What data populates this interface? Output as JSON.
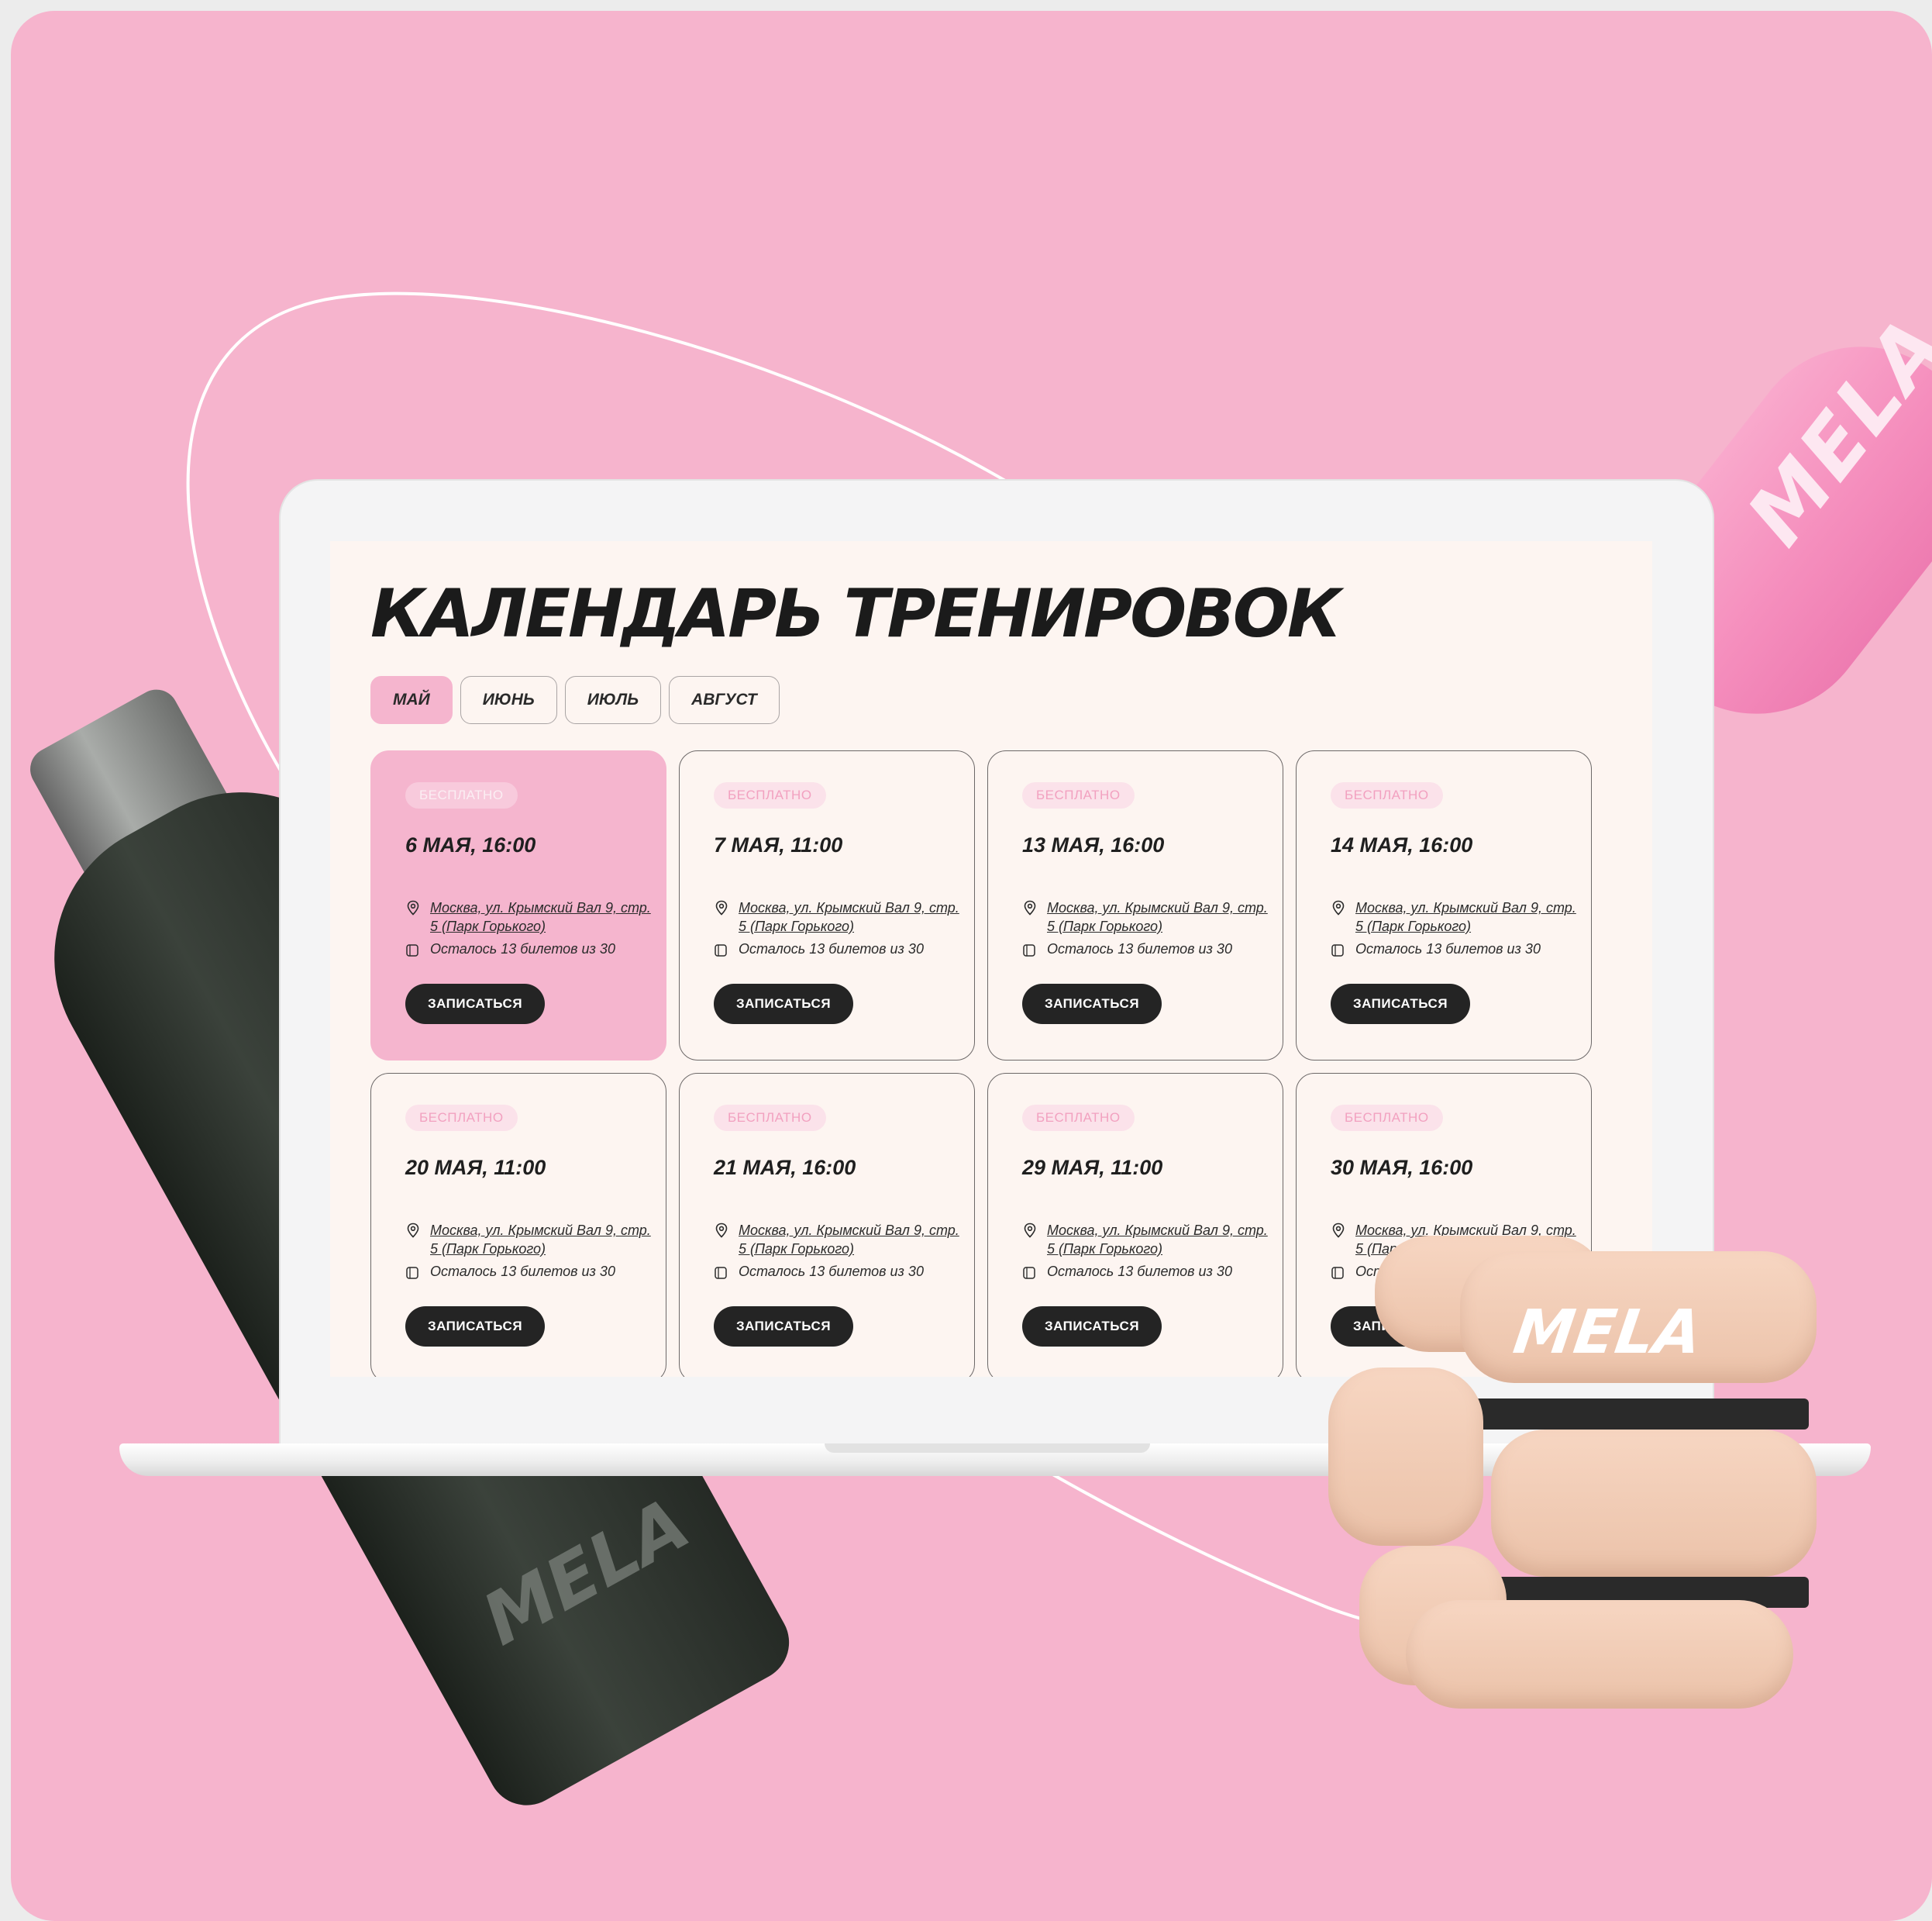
{
  "page": {
    "title": "КАЛЕНДАРЬ ТРЕНИРОВОК",
    "brand": "MELA",
    "accent_color": "#f5b5ce",
    "dark_color": "#242424",
    "background_color": "#f6b4cd"
  },
  "tabs": [
    {
      "label": "МАЙ",
      "active": true
    },
    {
      "label": "ИЮНЬ",
      "active": false
    },
    {
      "label": "ИЮЛЬ",
      "active": false
    },
    {
      "label": "АВГУСТ",
      "active": false
    }
  ],
  "cards": [
    {
      "badge": "БЕСПЛАТНО",
      "date": "6 МАЯ, 16:00",
      "address": "Москва, ул. Крымский Вал 9, стр. 5 (Парк Горького)",
      "tickets": "Осталось 13 билетов из 30",
      "button": "ЗАПИСАТЬСЯ",
      "highlighted": true
    },
    {
      "badge": "БЕСПЛАТНО",
      "date": "7 МАЯ, 11:00",
      "address": "Москва, ул. Крымский Вал 9, стр. 5 (Парк Горького)",
      "tickets": "Осталось 13 билетов из 30",
      "button": "ЗАПИСАТЬСЯ",
      "highlighted": false
    },
    {
      "badge": "БЕСПЛАТНО",
      "date": "13 МАЯ, 16:00",
      "address": "Москва, ул. Крымский Вал 9, стр. 5 (Парк Горького)",
      "tickets": "Осталось 13 билетов из 30",
      "button": "ЗАПИСАТЬСЯ",
      "highlighted": false
    },
    {
      "badge": "БЕСПЛАТНО",
      "date": "14 МАЯ, 16:00",
      "address": "Москва, ул. Крымский Вал 9, стр. 5 (Парк Горького)",
      "tickets": "Осталось 13 билетов из 30",
      "button": "ЗАПИСАТЬСЯ",
      "highlighted": false
    },
    {
      "badge": "БЕСПЛАТНО",
      "date": "20 МАЯ, 11:00",
      "address": "Москва, ул. Крымский Вал 9, стр. 5 (Парк Горького)",
      "tickets": "Осталось 13 билетов из 30",
      "button": "ЗАПИСАТЬСЯ",
      "highlighted": false
    },
    {
      "badge": "БЕСПЛАТНО",
      "date": "21 МАЯ, 16:00",
      "address": "Москва, ул. Крымский Вал 9, стр. 5 (Парк Горького)",
      "tickets": "Осталось 13 билетов из 30",
      "button": "ЗАПИСАТЬСЯ",
      "highlighted": false
    },
    {
      "badge": "БЕСПЛАТНО",
      "date": "29 МАЯ, 11:00",
      "address": "Москва, ул. Крымский Вал 9, стр. 5 (Парк Горького)",
      "tickets": "Осталось 13 билетов из 30",
      "button": "ЗАПИСАТЬСЯ",
      "highlighted": false
    },
    {
      "badge": "БЕСПЛАТНО",
      "date": "30 МАЯ, 16:00",
      "address": "Москва, ул. Крымский Вал 9, стр. 5 (Парк Горького)",
      "tickets": "Осталось 13 билетов из 30",
      "button": "ЗАПИСАТЬСЯ",
      "highlighted": false
    }
  ]
}
